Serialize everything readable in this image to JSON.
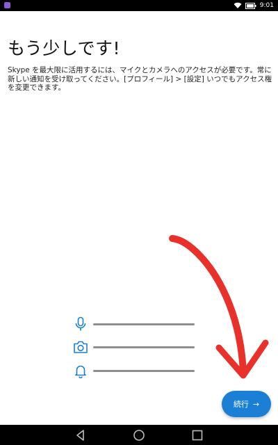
{
  "status_bar": {
    "time": "9:01",
    "icons": [
      "app-notification-icon",
      "wifi-icon",
      "battery-icon"
    ]
  },
  "onboarding": {
    "title": "もう少しです!",
    "description": "Skype を最大限に活用するには、マイクとカメラへのアクセスが必要です。常に新しい通知を受け取ってください。[プロフィール] > [設定] いつでもアクセス権を変更できます。",
    "permissions": [
      {
        "icon": "microphone-icon"
      },
      {
        "icon": "camera-icon"
      },
      {
        "icon": "notification-bell-icon"
      }
    ],
    "continue_label": "続行",
    "continue_arrow": "→"
  },
  "colors": {
    "accent": "#1b7fd6",
    "icon_blue": "#1b7fd6",
    "line_gray": "#8e8e8e",
    "annotation_red": "#e8312a"
  },
  "nav_bar": {
    "buttons": [
      "back-icon",
      "home-icon",
      "recents-icon"
    ]
  }
}
